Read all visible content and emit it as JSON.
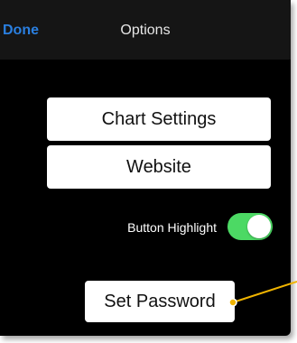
{
  "navbar": {
    "done_label": "Done",
    "title": "Options"
  },
  "buttons": {
    "chart_settings": "Chart Settings",
    "website": "Website",
    "set_password": "Set Password"
  },
  "toggle": {
    "label": "Button Highlight",
    "on": true
  },
  "colors": {
    "accent_blue": "#2a7fe0",
    "toggle_on": "#4cd964",
    "callout": "#f0b400"
  }
}
